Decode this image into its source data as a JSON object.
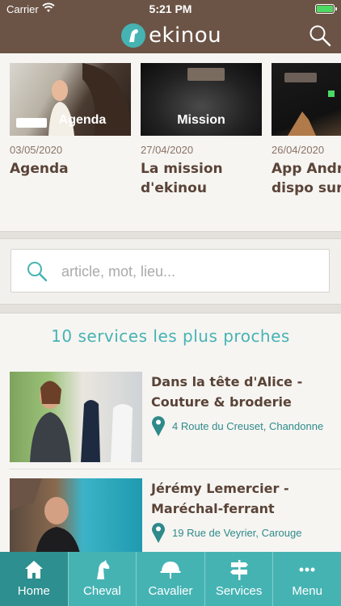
{
  "status": {
    "carrier": "Carrier",
    "time": "5:21 PM"
  },
  "brand": {
    "name": "ekinou"
  },
  "news": [
    {
      "date": "03/05/2020",
      "title": "Agenda",
      "caption": "Agenda"
    },
    {
      "date": "27/04/2020",
      "title": "La mission d'ekinou",
      "caption": "Mission"
    },
    {
      "date": "26/04/2020",
      "title": "App Android dispo sur",
      "caption": ""
    }
  ],
  "search": {
    "placeholder": "article, mot, lieu..."
  },
  "services": {
    "heading": "10 services les plus proches",
    "items": [
      {
        "name": "Dans la tête d'Alice - Couture & broderie",
        "address": "4 Route du Creuset, Chandonne"
      },
      {
        "name": "Jérémy Lemercier - Maréchal-ferrant",
        "address": "19 Rue de Veyrier, Carouge"
      }
    ]
  },
  "tabs": [
    {
      "label": "Home",
      "icon": "home-icon"
    },
    {
      "label": "Cheval",
      "icon": "horse-icon"
    },
    {
      "label": "Cavalier",
      "icon": "riding-helmet-icon"
    },
    {
      "label": "Services",
      "icon": "signpost-icon"
    },
    {
      "label": "Menu",
      "icon": "more-icon"
    }
  ],
  "colors": {
    "brown": "#6b5446",
    "teal": "#46b3b3",
    "teal_dark": "#2d8f8f"
  }
}
